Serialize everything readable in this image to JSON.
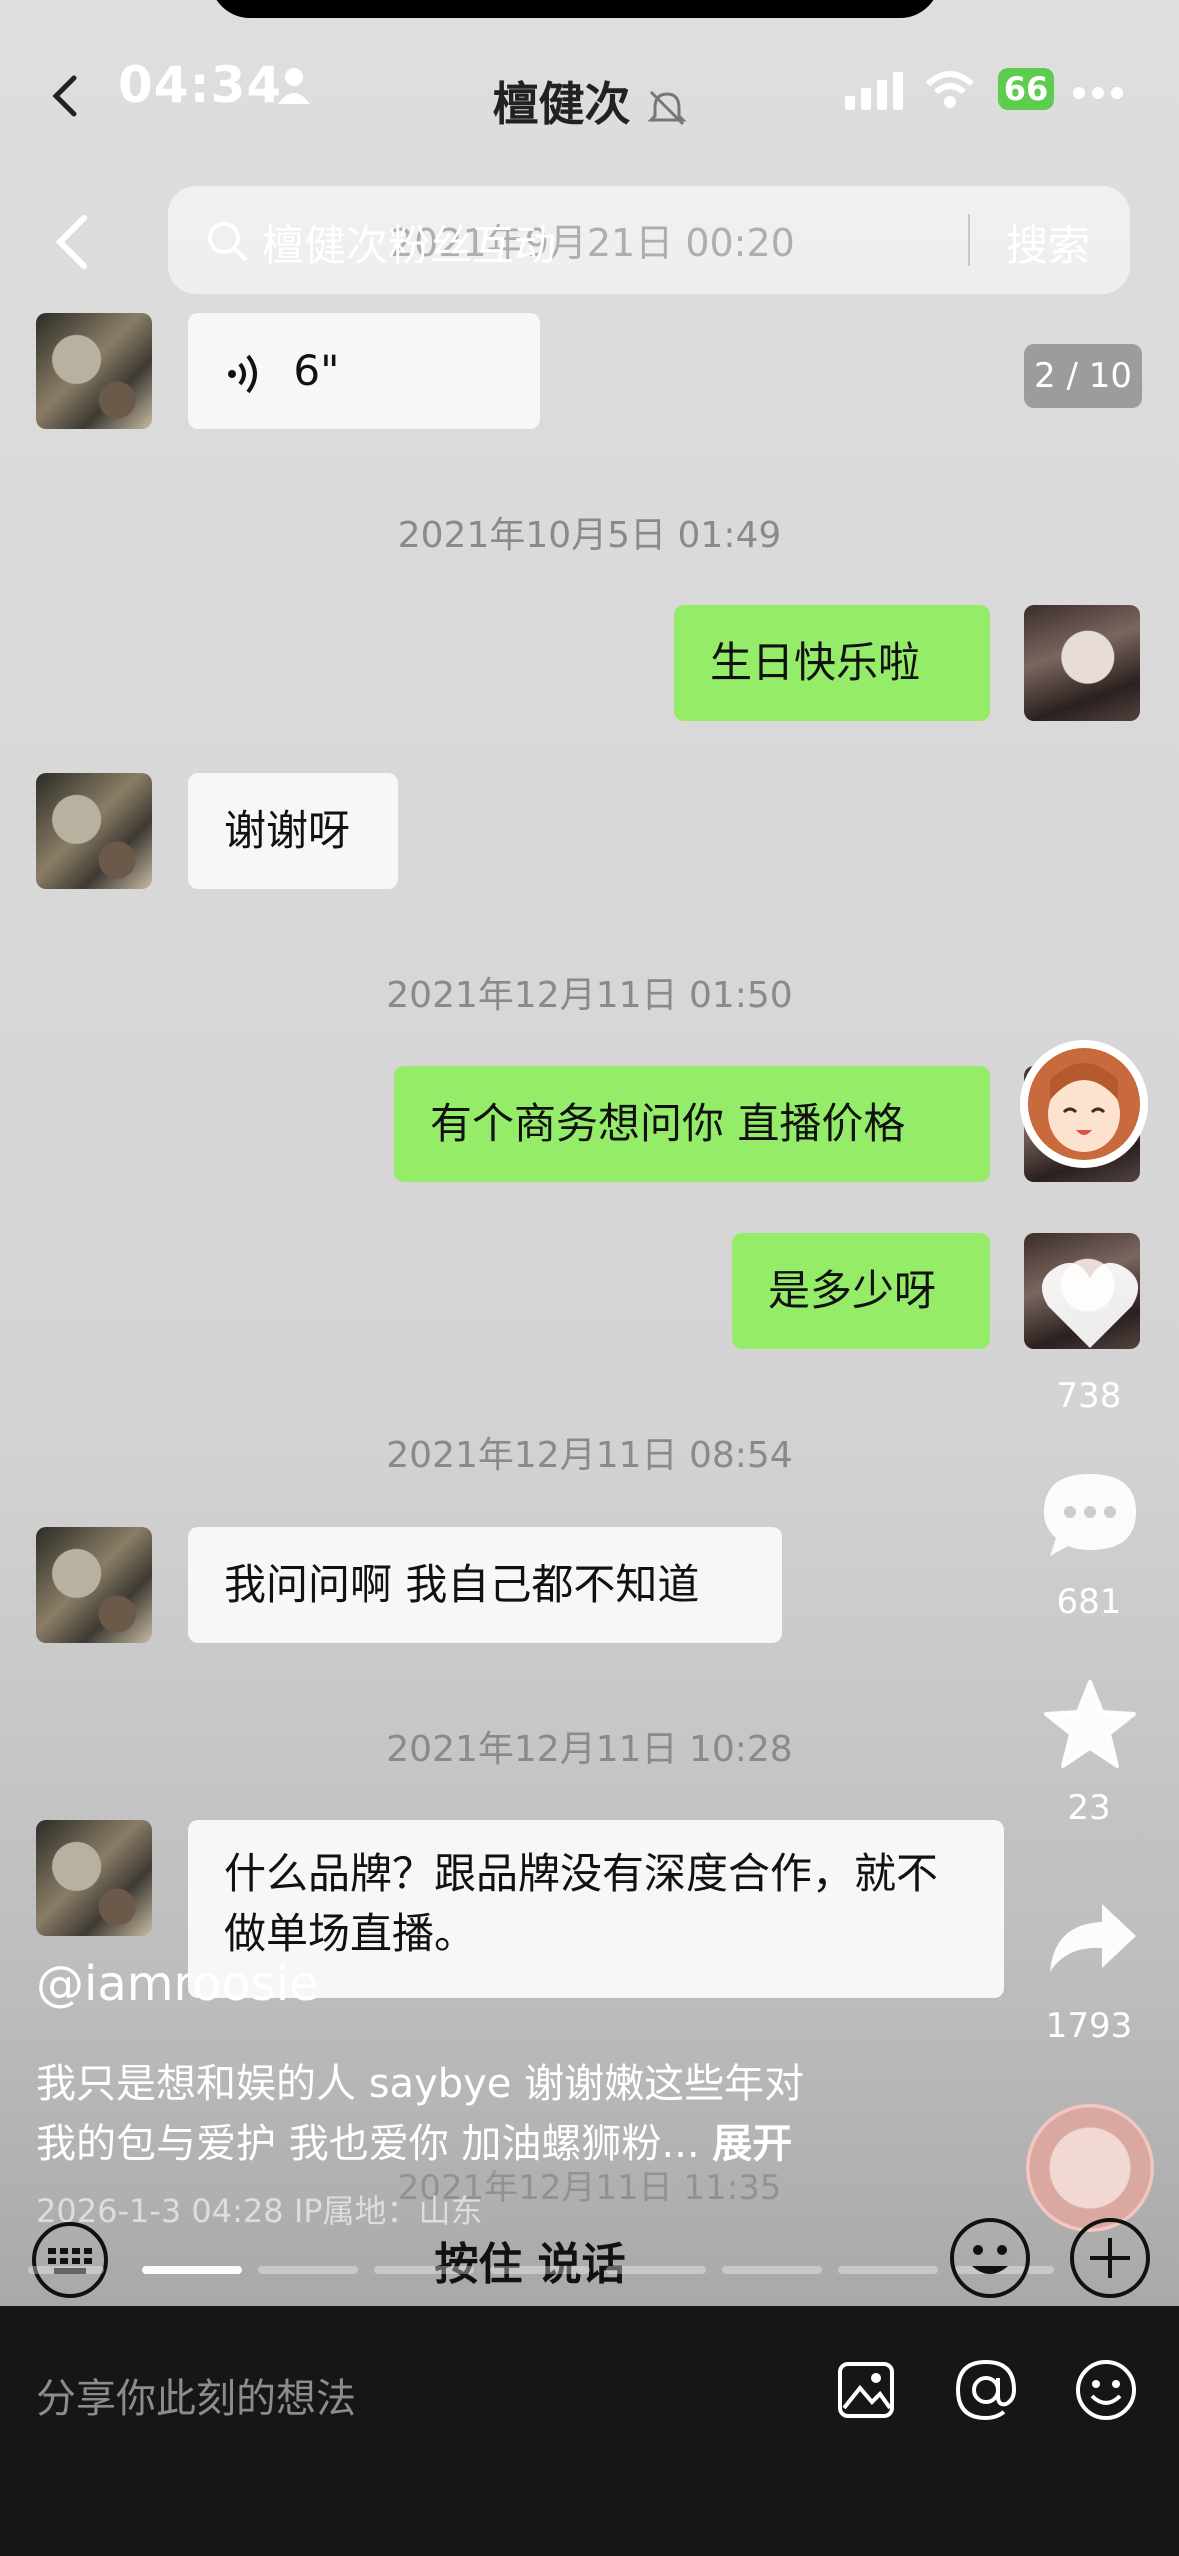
{
  "status_bar": {
    "time": "04:34",
    "battery": "66"
  },
  "chat": {
    "title": "檀健次",
    "search_placeholder": "檀健次粉丝互动",
    "search_button": "搜索",
    "messages": [
      {
        "type": "timestamp",
        "text": "2021年9月21日 00:20"
      },
      {
        "type": "voice",
        "side": "in",
        "text": "6\""
      },
      {
        "type": "timestamp",
        "text": "2021年10月5日 01:49"
      },
      {
        "type": "text",
        "side": "out",
        "text": "生日快乐啦"
      },
      {
        "type": "text",
        "side": "in",
        "text": "谢谢呀"
      },
      {
        "type": "timestamp",
        "text": "2021年12月11日 01:50"
      },
      {
        "type": "text",
        "side": "out",
        "text": "有个商务想问你 直播价格"
      },
      {
        "type": "text",
        "side": "out",
        "text": "是多少呀"
      },
      {
        "type": "timestamp",
        "text": "2021年12月11日 08:54"
      },
      {
        "type": "text",
        "side": "in",
        "text": "我问问啊 我自己都不知道"
      },
      {
        "type": "timestamp",
        "text": "2021年12月11日 10:28"
      },
      {
        "type": "text",
        "side": "in",
        "text": "什么品牌？跟品牌没有深度合作，就不做单场直播。"
      },
      {
        "type": "timestamp",
        "text": "2021年12月11日 11:35"
      }
    ],
    "hold_to_talk": "按住 说话"
  },
  "post": {
    "page_indicator": "2 / 10",
    "likes": "738",
    "comments": "681",
    "favorites": "23",
    "shares": "1793",
    "username": "@iamroosie",
    "caption_line1": "我只是想和娱的人 saybye 谢谢嫩这些年对",
    "caption_line2": "我的包与爱护 我也爱你 加油螺狮粉...",
    "expand_label": "展开",
    "datetime_location": "2026-1-3 04:28  IP属地：山东",
    "share_placeholder": "分享你此刻的想法",
    "progress_segments": 13,
    "progress_active_index": 1
  },
  "icons": [
    "back-icon",
    "person-icon",
    "mute-bell-icon",
    "signal-icon",
    "wifi-icon",
    "more-icon",
    "search-icon",
    "voice-icon",
    "heart-icon",
    "comment-icon",
    "star-icon",
    "share-icon",
    "keyboard-icon",
    "emoji-icon",
    "plus-icon",
    "image-icon",
    "at-icon",
    "smile-icon"
  ],
  "colors": {
    "outgoing_bubble": "#95ec69",
    "incoming_bubble": "#f7f7f7",
    "bottom_bar": "#161616"
  }
}
